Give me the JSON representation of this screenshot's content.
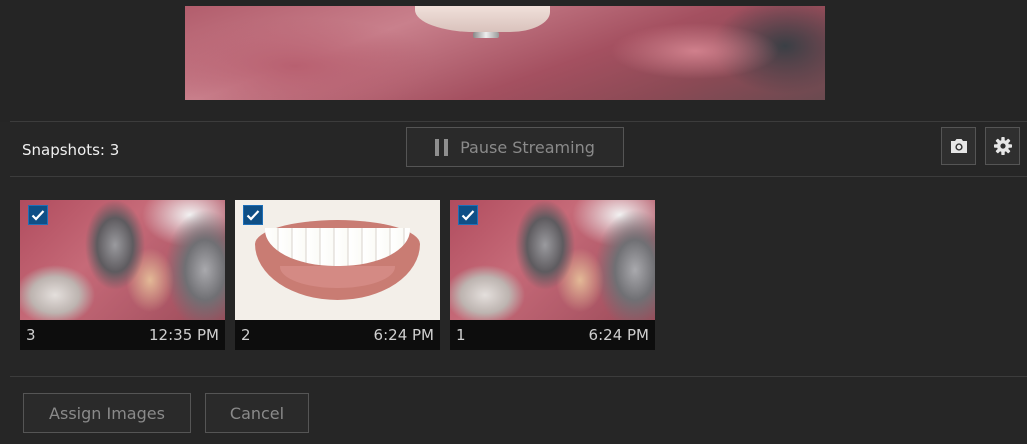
{
  "toolbar": {
    "snapshots_label": "Snapshots: 3",
    "pause_label": "Pause Streaming",
    "camera_icon": "camera-icon",
    "settings_icon": "gear-icon"
  },
  "snapshots": [
    {
      "number": "3",
      "time": "12:35 PM",
      "checked": true,
      "image": "intraoral-metal-crown"
    },
    {
      "number": "2",
      "time": "6:24 PM",
      "checked": true,
      "image": "smile"
    },
    {
      "number": "1",
      "time": "6:24 PM",
      "checked": true,
      "image": "intraoral-metal-crown"
    }
  ],
  "footer": {
    "assign_label": "Assign Images",
    "cancel_label": "Cancel"
  },
  "colors": {
    "background": "#252525",
    "checkbox": "#0f4f86",
    "button_border": "#555555",
    "disabled_text": "#8a8a8a"
  }
}
